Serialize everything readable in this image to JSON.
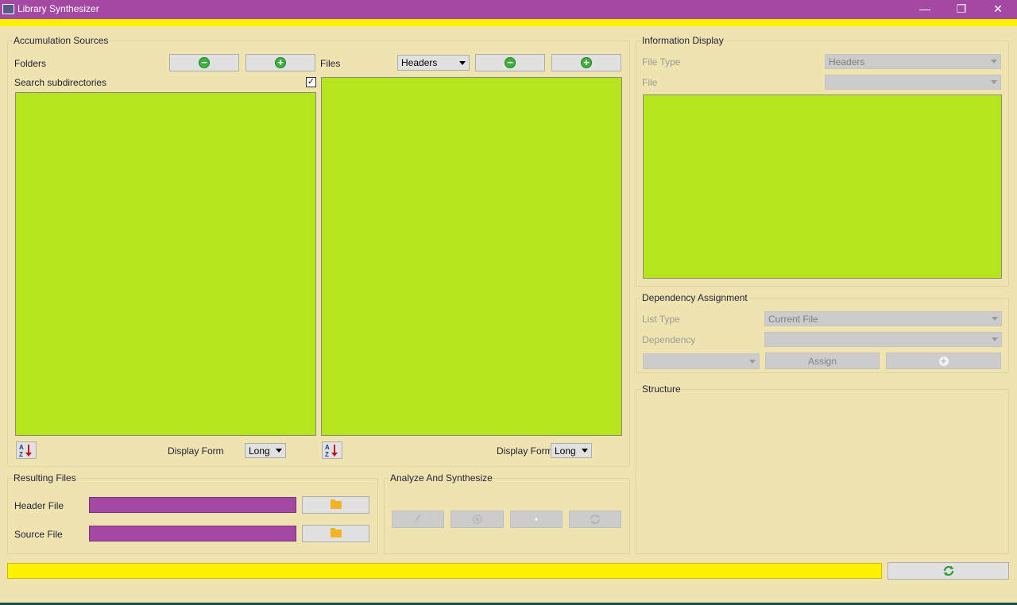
{
  "window": {
    "title": "Library Synthesizer",
    "controls": {
      "minimize": "—",
      "maximize": "❐",
      "close": "✕"
    }
  },
  "accumulation": {
    "title": "Accumulation Sources",
    "folders_label": "Folders",
    "files_label": "Files",
    "search_subdirs_label": "Search subdirectories",
    "search_subdirs_checked": true,
    "check_mark": "✓",
    "files_filter_value": "Headers",
    "remove_glyph": "−",
    "add_glyph": "+",
    "sort_glyph": "AZ",
    "folders_display_form_label": "Display Form",
    "folders_display_form_value": "Long",
    "files_display_form_label": "Display Form",
    "files_display_form_value": "Long"
  },
  "info": {
    "title": "Information Display",
    "file_type_label": "File Type",
    "file_type_value": "Headers",
    "file_label": "File",
    "file_value": ""
  },
  "dependency": {
    "title": "Dependency Assignment",
    "list_type_label": "List Type",
    "list_type_value": "Current File",
    "dependency_label": "Dependency",
    "dependency_value": "",
    "extra_combo_value": "",
    "assign_label": "Assign",
    "add_glyph": "+"
  },
  "structure": {
    "title": "Structure"
  },
  "resulting": {
    "title": "Resulting Files",
    "header_label": "Header File",
    "source_label": "Source File"
  },
  "analyze": {
    "title": "Analyze And Synthesize",
    "icons": [
      "broom-icon",
      "gear-icon",
      "dot-icon",
      "refresh-icon"
    ]
  },
  "colors": {
    "titlebar": "#a349a4",
    "background": "#efe4b0",
    "list_green": "#b5e61d",
    "progress_yellow": "#fff200",
    "field_purple": "#a349a4"
  }
}
